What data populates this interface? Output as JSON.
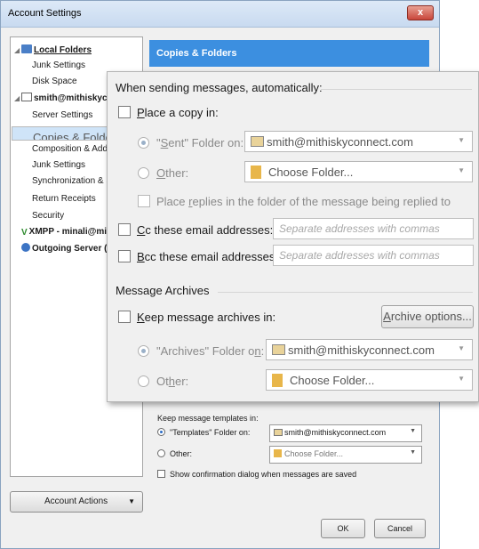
{
  "window": {
    "title": "Account Settings",
    "close_label": "x"
  },
  "sidebar": {
    "items": [
      {
        "label": "Local Folders"
      },
      {
        "label": "Junk Settings"
      },
      {
        "label": "Disk Space"
      },
      {
        "label": "smith@mithiskyco"
      },
      {
        "label": "Server Settings"
      },
      {
        "label": "Copies & Folders"
      },
      {
        "label": "Composition & Addr"
      },
      {
        "label": "Junk Settings"
      },
      {
        "label": "Synchronization & St"
      },
      {
        "label": "Return Receipts"
      },
      {
        "label": "Security"
      },
      {
        "label": "XMPP - minali@mi"
      },
      {
        "label": "Outgoing Server ("
      }
    ],
    "account_actions": "Account Actions"
  },
  "panel": {
    "heading": "Copies & Folders",
    "templates_label": "Keep message templates in:",
    "templates_folder_label": "\"Templates\" Folder on:",
    "templates_account": "smith@mithiskyconnect.com",
    "templates_other_label": "Other:",
    "templates_choose": "Choose Folder...",
    "show_confirmation": "Show confirmation dialog when messages are saved",
    "ok": "OK",
    "cancel": "Cancel"
  },
  "zoom": {
    "sending_heading": "When sending messages, automatically:",
    "place_copy": {
      "prefix": "P",
      "rest": "lace a copy in:"
    },
    "sent_folder": {
      "before": "\"",
      "accel": "S",
      "after": "ent\" Folder on:"
    },
    "sent_account": "smith@mithiskyconnect.com",
    "other1": {
      "accel": "O",
      "rest": "ther:"
    },
    "choose1": "Choose Folder...",
    "place_replies": {
      "before": "Place ",
      "accel": "r",
      "after": "eplies in the folder of the message being replied to"
    },
    "cc": {
      "accel": "C",
      "rest": "c these email addresses:"
    },
    "cc_placeholder": "Separate addresses with commas",
    "bcc": {
      "accel": "B",
      "rest": "cc these email addresses:"
    },
    "bcc_placeholder": "Separate addresses with commas",
    "archives_heading": "Message Archives",
    "keep_archives": {
      "accel": "K",
      "rest": "eep message archives in:"
    },
    "archive_options": {
      "accel": "A",
      "rest": "rchive options..."
    },
    "archives_folder": {
      "before": "\"Archives\" Folder o",
      "accel": "n",
      "after": ":"
    },
    "archives_account": "smith@mithiskyconnect.com",
    "other2": {
      "before": "Ot",
      "accel": "h",
      "after": "er:"
    },
    "choose2": "Choose Folder..."
  }
}
